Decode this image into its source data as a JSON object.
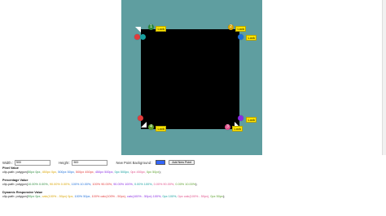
{
  "handles": [
    {
      "num": "1",
      "color": "#2e8b3d",
      "lock": "Lock"
    },
    {
      "num": "2",
      "color": "#1e6fd9",
      "lock": "Lock"
    },
    {
      "num": "3",
      "color": "#8a2be2",
      "lock": "Lock"
    },
    {
      "num": "4",
      "color": "#e23b3b",
      "lock": "Lock"
    }
  ],
  "controls": {
    "width_label": "Width :",
    "width_value": "500",
    "height_label": "Height :",
    "height_value": "500",
    "new_point_bg_label": "New Point Background :",
    "swatch_color": "#3366ff",
    "add_point_label": "Add New Point"
  },
  "pixel": {
    "title": "Pixel Value",
    "prefix": "clip-path: polygon(",
    "points": [
      "50px 0px,",
      "450px 0px,",
      "500px 50px,",
      "500px 450px,",
      "450px 500px,",
      "0px 500px,",
      "0px 450px,",
      "0px 50px"
    ],
    "suffix": ");"
  },
  "percentage": {
    "title": "Percentage Value",
    "prefix": "clip-path: polygon(",
    "points": [
      "10.00% 0.00%,",
      "90.00% 0.00%,",
      "100% 10.00%,",
      "100% 90.00%,",
      "90.00% 100%,",
      "0.00% 100%,",
      "0.00% 90.00%,",
      "0.00% 10.00%"
    ],
    "suffix": ");"
  },
  "dynamic": {
    "title": "Dynamic Responsive Value",
    "prefix": "clip-path: polygon(",
    "points": [
      "50px 0px,",
      "calc(100% - 50px) 0px,",
      "100% 50px,",
      "100% calc(100% - 50px),",
      "calc(100% - 50px) 100%,",
      "0px 100%,",
      "0px calc(100% - 50px),",
      "0px 50px"
    ],
    "suffix": ");"
  },
  "point_colors": [
    "#2e8b3d",
    "#d9a400",
    "#1e6fd9",
    "#e23b3b",
    "#8a2be2",
    "#18a0a0",
    "#e0508a",
    "#5a9f2a"
  ]
}
